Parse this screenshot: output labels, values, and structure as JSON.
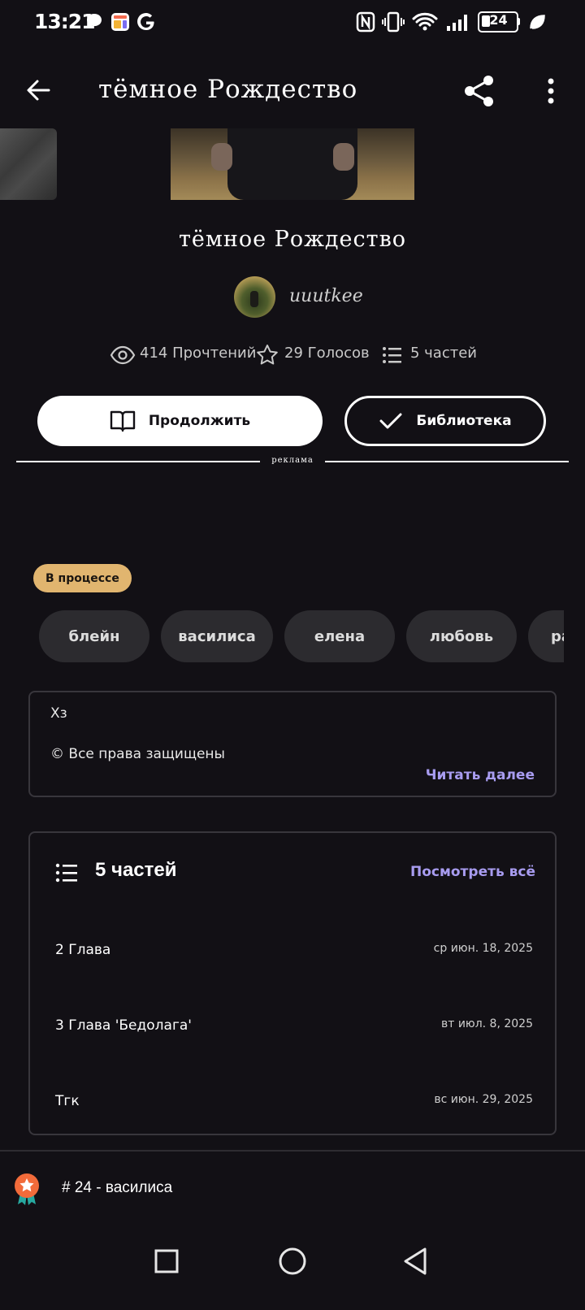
{
  "status_bar": {
    "time": "13:21",
    "battery": "24",
    "icons": [
      "chat-bubble-icon",
      "app-icon",
      "google-icon",
      "nfc-icon",
      "vibrate-icon",
      "wifi-icon",
      "signal-icon",
      "battery-icon",
      "leaf-icon"
    ]
  },
  "toolbar": {
    "title": "тёмное Рождество",
    "icons": [
      "back-arrow-icon",
      "share-icon",
      "more-vert-icon"
    ]
  },
  "story": {
    "title": "тёмное Рождество",
    "author": "uuutkee",
    "reads": "414 Прочтений",
    "votes": "29 Голосов",
    "parts_count": "5 частей"
  },
  "actions": {
    "continue_label": "Продолжить",
    "library_label": "Библиотека"
  },
  "ad": {
    "label": "реклама"
  },
  "status_badge": "В процессе",
  "tags": [
    "блейн",
    "василиса",
    "елена",
    "любовь",
    "ра"
  ],
  "description": {
    "line1": "Хз",
    "line2": "© Все права защищены",
    "read_more": "Читать далее"
  },
  "parts": {
    "title": "5 частей",
    "see_all": "Посмотреть всё",
    "items": [
      {
        "title": "2 Глава",
        "date": "ср июн. 18, 2025"
      },
      {
        "title": "3 Глава 'Бедолага'",
        "date": "вт июл. 8, 2025"
      },
      {
        "title": "Тгк",
        "date": "вс июн. 29, 2025"
      }
    ]
  },
  "ranking": {
    "text": "# 24 - василиса"
  },
  "colors": {
    "background": "#121015",
    "accent": "#a89cf0",
    "badge": "#e1b56f",
    "tag_bg": "#2c2b2f",
    "ranking_badge": "#f26b3a"
  }
}
